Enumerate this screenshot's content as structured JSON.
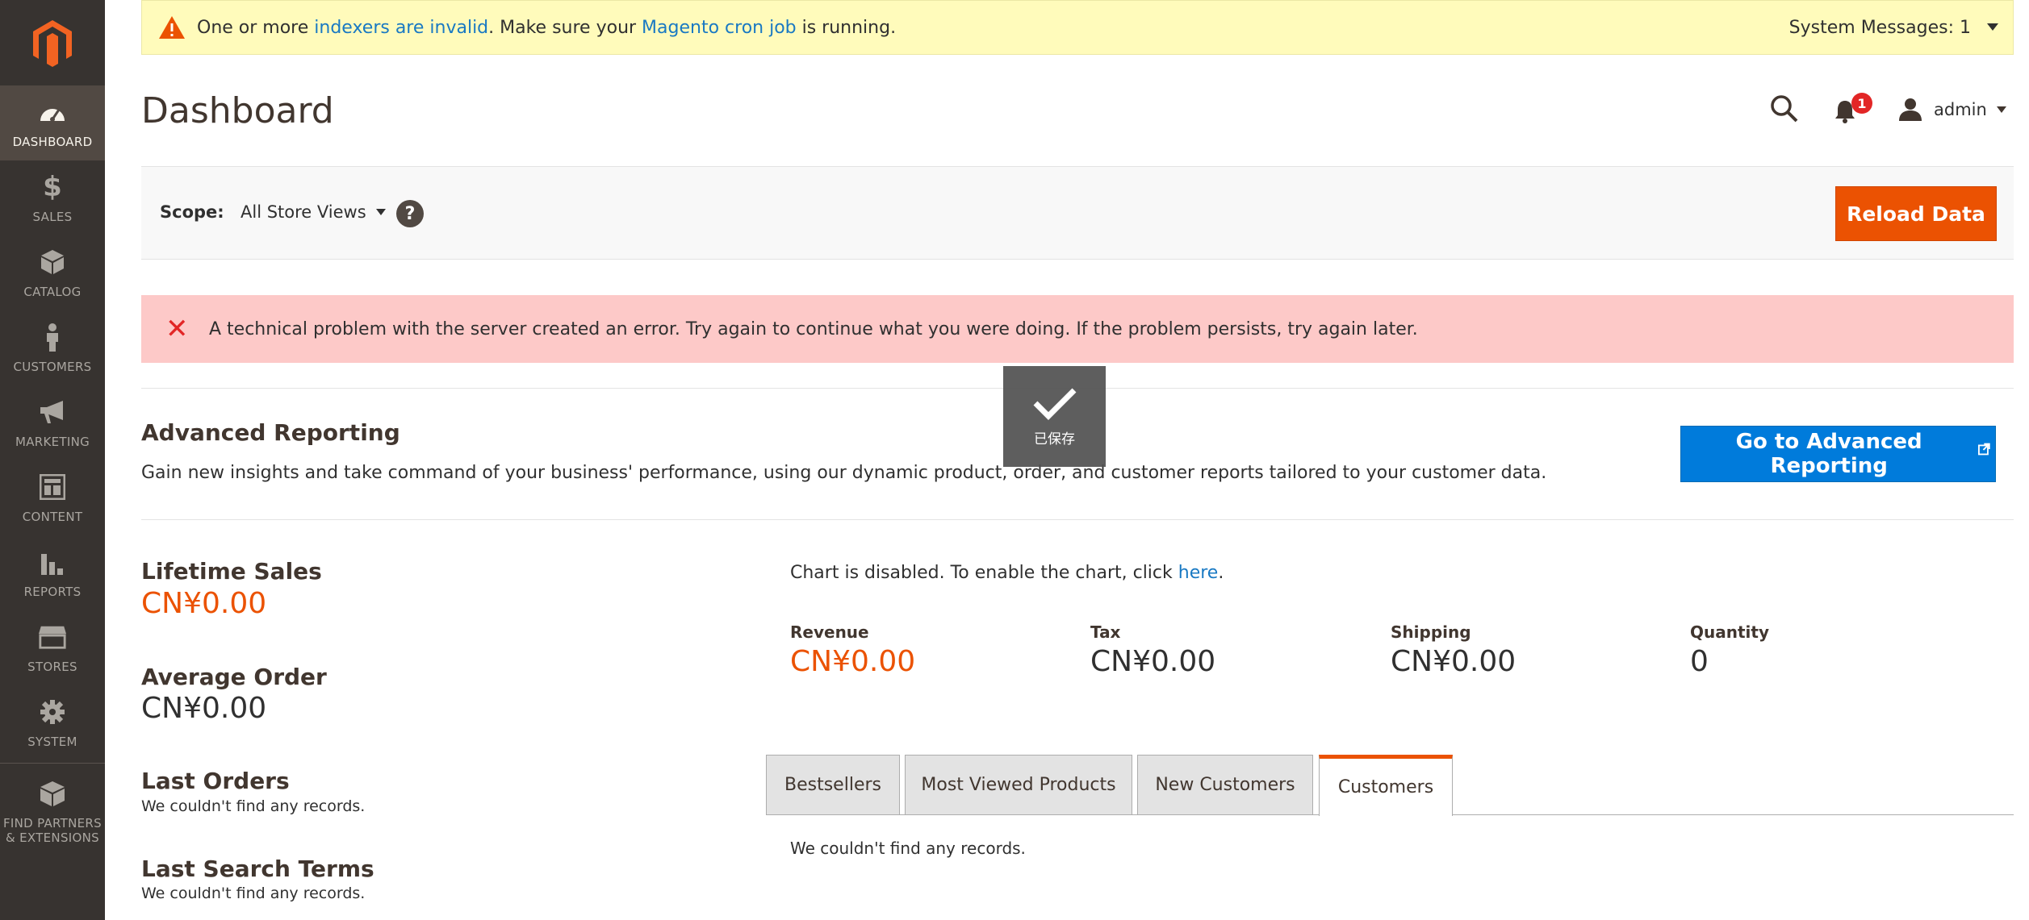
{
  "sidebar": {
    "items": [
      {
        "label": "DASHBOARD",
        "icon": "dashboard-icon"
      },
      {
        "label": "SALES",
        "icon": "dollar-icon"
      },
      {
        "label": "CATALOG",
        "icon": "cube-icon"
      },
      {
        "label": "CUSTOMERS",
        "icon": "person-icon"
      },
      {
        "label": "MARKETING",
        "icon": "megaphone-icon"
      },
      {
        "label": "CONTENT",
        "icon": "layout-icon"
      },
      {
        "label": "REPORTS",
        "icon": "bar-chart-icon"
      },
      {
        "label": "STORES",
        "icon": "storefront-icon"
      },
      {
        "label": "SYSTEM",
        "icon": "gear-icon"
      }
    ],
    "partners_line1": "FIND PARTNERS",
    "partners_line2": "& EXTENSIONS"
  },
  "system_message": {
    "prefix": "One or more ",
    "link1": "indexers are invalid",
    "middle": ". Make sure your ",
    "link2": "Magento cron job",
    "suffix": " is running.",
    "count_label": "System Messages: 1"
  },
  "header": {
    "title": "Dashboard",
    "notification_count": "1",
    "user": "admin"
  },
  "scope": {
    "label": "Scope:",
    "value": "All Store Views",
    "help": "?",
    "reload_label": "Reload Data"
  },
  "error": {
    "text": "A technical problem with the server created an error. Try again to continue what you were doing. If the problem persists, try again later."
  },
  "toast": {
    "label": "已保存"
  },
  "advanced": {
    "title": "Advanced Reporting",
    "description": "Gain new insights and take command of your business' performance, using our dynamic product, order, and customer reports tailored to your customer data.",
    "button": "Go to Advanced Reporting"
  },
  "stats": {
    "lifetime_label": "Lifetime Sales",
    "lifetime_value": "CN¥0.00",
    "average_label": "Average Order",
    "average_value": "CN¥0.00",
    "last_orders_label": "Last Orders",
    "last_orders_empty": "We couldn't find any records.",
    "last_search_label": "Last Search Terms",
    "last_search_empty": "We couldn't find any records."
  },
  "chart": {
    "note_prefix": "Chart is disabled. To enable the chart, click ",
    "note_link": "here",
    "note_suffix": "."
  },
  "totals": [
    {
      "label": "Revenue",
      "value": "CN¥0.00"
    },
    {
      "label": "Tax",
      "value": "CN¥0.00"
    },
    {
      "label": "Shipping",
      "value": "CN¥0.00"
    },
    {
      "label": "Quantity",
      "value": "0"
    }
  ],
  "tabs": [
    {
      "label": "Bestsellers"
    },
    {
      "label": "Most Viewed Products"
    },
    {
      "label": "New Customers"
    },
    {
      "label": "Customers"
    }
  ],
  "tab_content": {
    "empty": "We couldn't find any records."
  },
  "colors": {
    "accent": "#eb5202",
    "link": "#1979c3",
    "sidebar": "#373330",
    "error_bg": "#fdc9c8",
    "notice_bg": "#fffbbb"
  }
}
